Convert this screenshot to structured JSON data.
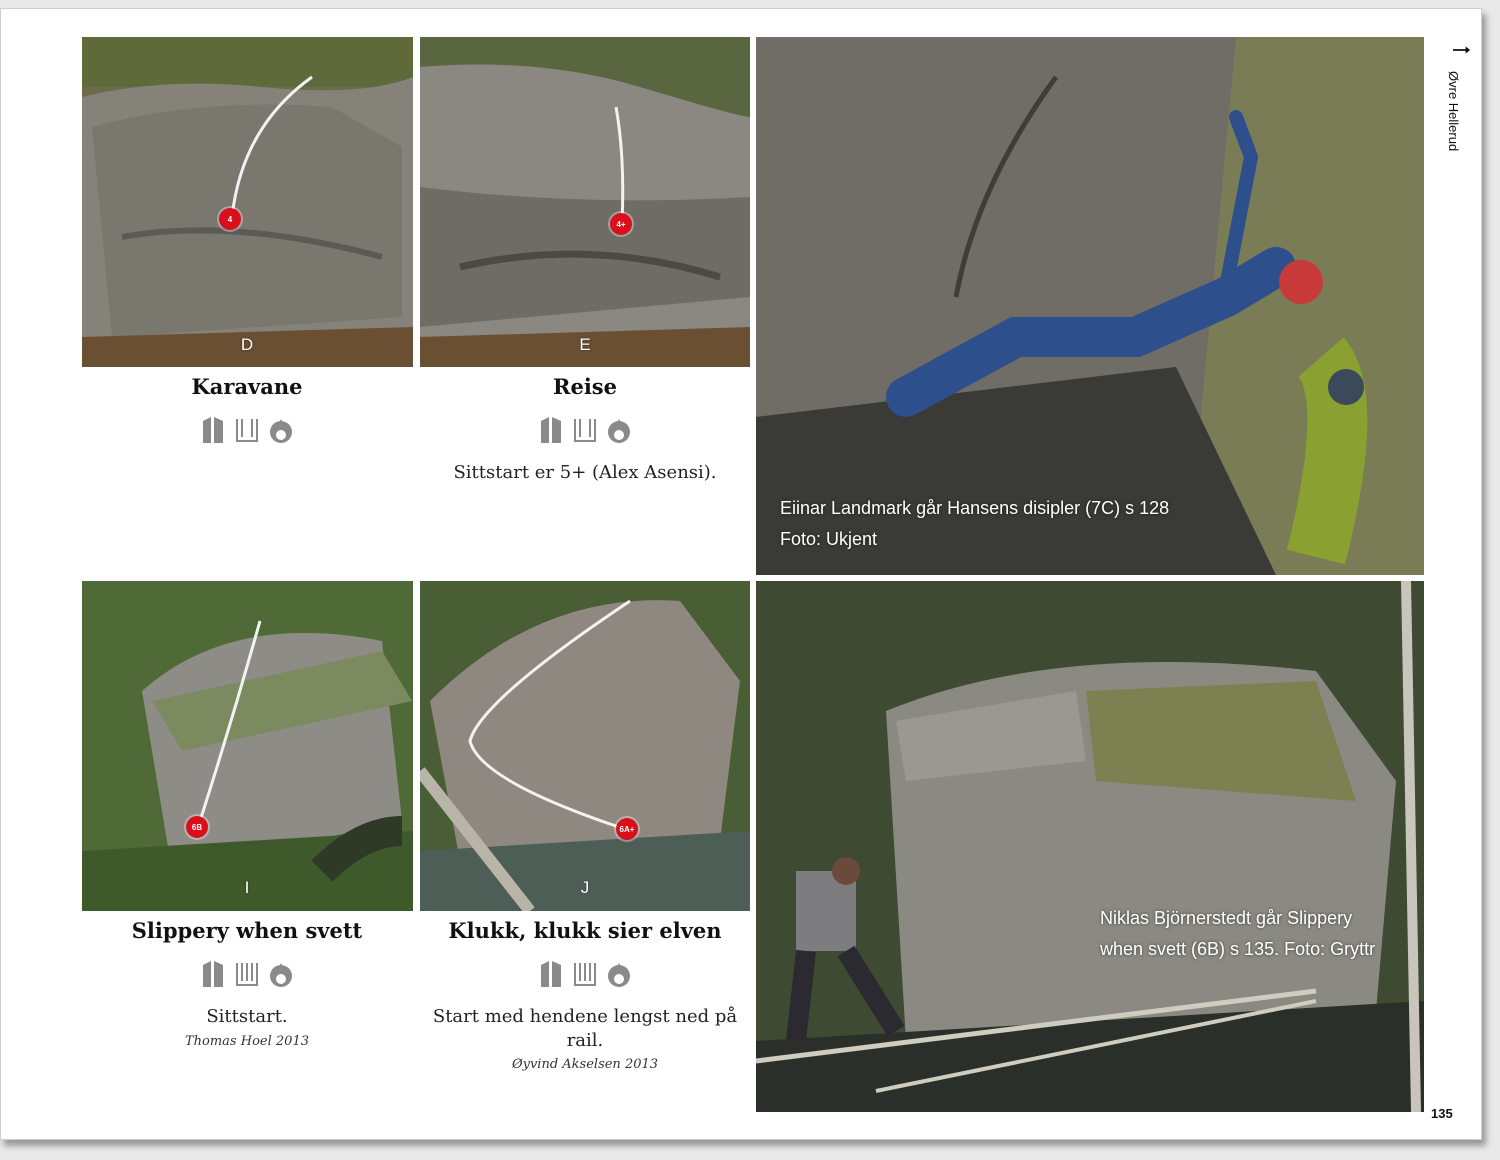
{
  "page": {
    "section": "Øvre Hellerud",
    "page_number": "135"
  },
  "routes": [
    {
      "letter": "D",
      "grade": "4",
      "name": "Karavane",
      "description": "",
      "fa_name": "",
      "fa_year": ""
    },
    {
      "letter": "E",
      "grade": "4+",
      "name": "Reise",
      "description": "Sittstart er 5+ (Alex Asensi).",
      "fa_name": "",
      "fa_year": ""
    },
    {
      "letter": "I",
      "grade": "6B",
      "name": "Slippery when svett",
      "description": "Sittstart.",
      "fa_name": "Thomas Hoel",
      "fa_year": "2013"
    },
    {
      "letter": "J",
      "grade": "6A+",
      "name": "Klukk, klukk sier elven",
      "description": "Start med hendene lengst ned på rail.",
      "fa_name": "Øyvind Akselsen",
      "fa_year": "2013"
    }
  ],
  "captions": {
    "top_line1": "Eiinar Landmark går Hansens disipler (7C) s 128",
    "top_line2": "Foto: Ukjent",
    "bottom_line1": "Niklas Björnerstedt går Slippery",
    "bottom_line2": "when svett (6B) s 135. Foto: Gryttr"
  },
  "icons": [
    "highball-icon",
    "landing-icon",
    "sitstart-icon"
  ],
  "colors": {
    "grade_dot": "#d9101c",
    "icon_gray": "#8a8a8a"
  }
}
